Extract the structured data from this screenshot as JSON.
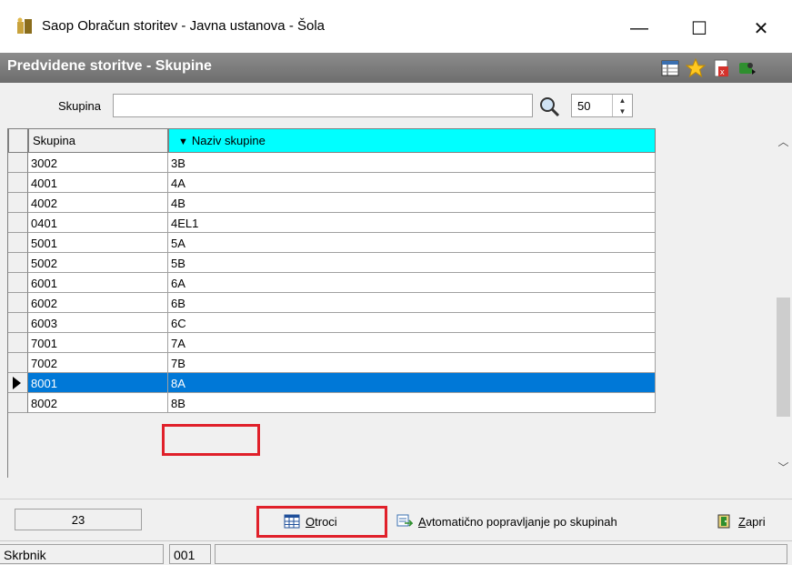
{
  "window": {
    "title": "Saop  Obračun storitev - Javna ustanova - Šola",
    "minimize_symbol": "—",
    "maximize_symbol": "☐",
    "close_symbol": "✕"
  },
  "subtitle": "Predvidene storitve - Skupine",
  "toolbar_icons": [
    "columns-icon",
    "star-icon",
    "excel-export-icon",
    "exit-icon"
  ],
  "search": {
    "label": "Skupina",
    "value": "",
    "placeholder": "",
    "limit_value": "50"
  },
  "grid": {
    "columns": [
      "Skupina",
      "Naziv skupine"
    ],
    "sorted_column": "Naziv skupine",
    "rows": [
      {
        "skupina": "3002",
        "naziv": "3B"
      },
      {
        "skupina": "4001",
        "naziv": "4A"
      },
      {
        "skupina": "4002",
        "naziv": "4B"
      },
      {
        "skupina": "0401",
        "naziv": "4EL1"
      },
      {
        "skupina": "5001",
        "naziv": "5A"
      },
      {
        "skupina": "5002",
        "naziv": "5B"
      },
      {
        "skupina": "6001",
        "naziv": "6A"
      },
      {
        "skupina": "6002",
        "naziv": "6B"
      },
      {
        "skupina": "6003",
        "naziv": "6C"
      },
      {
        "skupina": "7001",
        "naziv": "7A"
      },
      {
        "skupina": "7002",
        "naziv": "7B"
      },
      {
        "skupina": "8001",
        "naziv": "8A"
      },
      {
        "skupina": "8002",
        "naziv": "8B"
      }
    ],
    "selected_row": 11
  },
  "bottom": {
    "count": "23",
    "otroci_label": "Otroci",
    "otroci_underline": "O",
    "otroci_rest": "troci",
    "avto_underline": "A",
    "avto_rest": "vtomatično popravljanje po skupinah",
    "zapri_underline": "Z",
    "zapri_rest": "apri"
  },
  "status": {
    "field1": "Skrbnik",
    "field2": "001",
    "field3": ""
  },
  "colors": {
    "selection": "#0078d7",
    "sorted_header": "#00ffff",
    "highlight": "#e0202a"
  }
}
